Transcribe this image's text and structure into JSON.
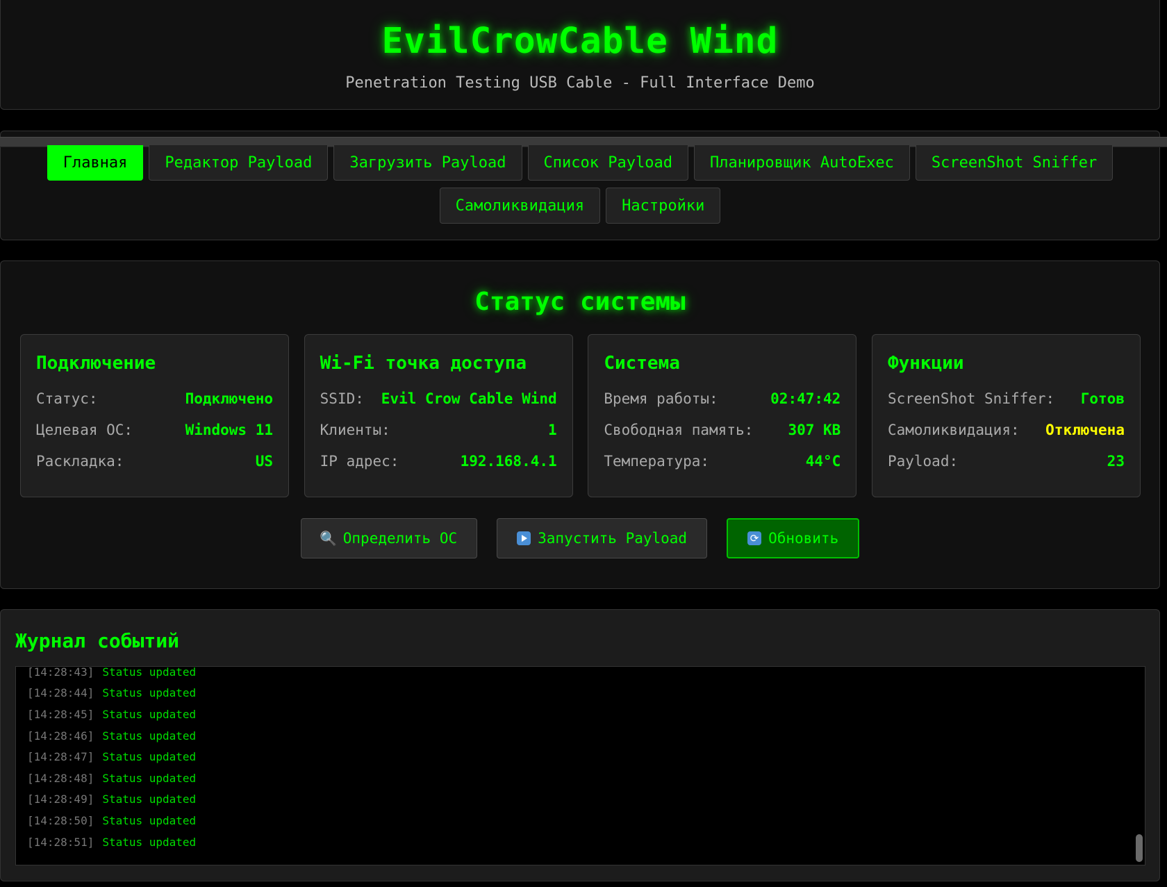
{
  "header": {
    "title": "EvilCrowCable Wind",
    "subtitle": "Penetration Testing USB Cable - Full Interface Demo"
  },
  "nav": {
    "tabs": [
      {
        "label": "Главная",
        "active": true
      },
      {
        "label": "Редактор Payload",
        "active": false
      },
      {
        "label": "Загрузить Payload",
        "active": false
      },
      {
        "label": "Список Payload",
        "active": false
      },
      {
        "label": "Планировщик AutoExec",
        "active": false
      },
      {
        "label": "ScreenShot Sniffer",
        "active": false
      },
      {
        "label": "Самоликвидация",
        "active": false
      },
      {
        "label": "Настройки",
        "active": false
      }
    ]
  },
  "status": {
    "title": "Статус системы",
    "cards": [
      {
        "title": "Подключение",
        "rows": [
          {
            "key": "Статус:",
            "value": "Подключено"
          },
          {
            "key": "Целевая ОС:",
            "value": "Windows 11"
          },
          {
            "key": "Раскладка:",
            "value": "US"
          }
        ]
      },
      {
        "title": "Wi-Fi точка доступа",
        "rows": [
          {
            "key": "SSID:",
            "value": "Evil Crow Cable Wind"
          },
          {
            "key": "Клиенты:",
            "value": "1"
          },
          {
            "key": "IP адрес:",
            "value": "192.168.4.1"
          }
        ]
      },
      {
        "title": "Система",
        "rows": [
          {
            "key": "Время работы:",
            "value": "02:47:42"
          },
          {
            "key": "Свободная память:",
            "value": "307 KB"
          },
          {
            "key": "Температура:",
            "value": "44°C"
          }
        ]
      },
      {
        "title": "Функции",
        "rows": [
          {
            "key": "ScreenShot Sniffer:",
            "value": "Готов"
          },
          {
            "key": "Самоликвидация:",
            "value": "Отключена"
          },
          {
            "key": "Payload:",
            "value": "23"
          }
        ]
      }
    ],
    "actions": {
      "detect_os": "Определить ОС",
      "run_payload": "Запустить Payload",
      "refresh": "Обновить"
    },
    "icons": {
      "detect_os": "magnifier-icon",
      "run_payload": "play-icon",
      "refresh": "refresh-icon"
    }
  },
  "log": {
    "title": "Журнал событий",
    "entries": [
      {
        "time": "[14:28:43]",
        "message": "Status updated"
      },
      {
        "time": "[14:28:44]",
        "message": "Status updated"
      },
      {
        "time": "[14:28:45]",
        "message": "Status updated"
      },
      {
        "time": "[14:28:46]",
        "message": "Status updated"
      },
      {
        "time": "[14:28:47]",
        "message": "Status updated"
      },
      {
        "time": "[14:28:48]",
        "message": "Status updated"
      },
      {
        "time": "[14:28:49]",
        "message": "Status updated"
      },
      {
        "time": "[14:28:50]",
        "message": "Status updated"
      },
      {
        "time": "[14:28:51]",
        "message": "Status updated"
      }
    ]
  },
  "colors": {
    "accent": "#00ff00",
    "warning": "#ffff00",
    "background": "#000000",
    "panel": "#111111"
  }
}
